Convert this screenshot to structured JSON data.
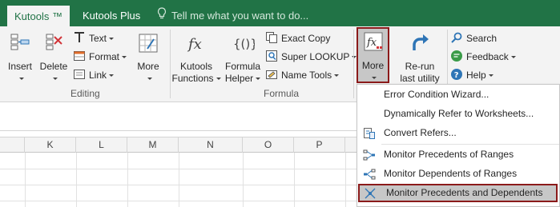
{
  "tabs": {
    "kutools": "Kutools ™",
    "kutools_plus": "Kutools Plus",
    "tell_me": "Tell me what you want to do..."
  },
  "editing": {
    "insert": "Insert",
    "delete": "Delete",
    "text": "Text",
    "format": "Format",
    "link": "Link",
    "more": "More",
    "group_label": "Editing"
  },
  "formula": {
    "kutools_functions_1": "Kutools",
    "kutools_functions_2": "Functions",
    "formula_helper_1": "Formula",
    "formula_helper_2": "Helper",
    "exact_copy": "Exact Copy",
    "super_lookup": "Super LOOKUP",
    "name_tools": "Name Tools",
    "more": "More",
    "group_label": "Formula"
  },
  "rerun": {
    "line1": "Re-run",
    "line2": "last utility"
  },
  "help": {
    "search": "Search",
    "feedback": "Feedback",
    "help": "Help"
  },
  "columns": [
    "K",
    "L",
    "M",
    "N",
    "O",
    "P"
  ],
  "dropdown": {
    "items": [
      "Error Condition Wizard...",
      "Dynamically Refer to Worksheets...",
      "Convert Refers...",
      "Monitor Precedents of Ranges",
      "Monitor Dependents of Ranges",
      "Monitor Precedents and Dependents"
    ]
  },
  "colors": {
    "excel_green": "#217346",
    "highlight_border": "#8b1a1a",
    "ribbon_bg": "#f3f3f3"
  }
}
